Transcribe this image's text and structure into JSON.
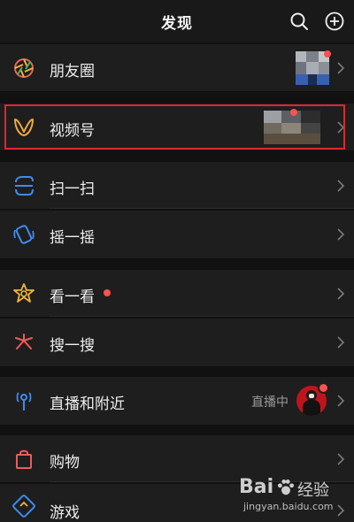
{
  "header": {
    "title": "发现",
    "search_icon": "search-icon",
    "add_icon": "plus-circle-icon"
  },
  "items": [
    {
      "label": "朋友圈",
      "icon": "moments-aperture-icon",
      "icon_color": "#e06a52"
    },
    {
      "label": "视频号",
      "icon": "channels-butterfly-icon",
      "icon_color": "#f2a93b"
    },
    {
      "label": "扫一扫",
      "icon": "scan-icon",
      "icon_color": "#3d8cf0"
    },
    {
      "label": "摇一摇",
      "icon": "shake-phone-icon",
      "icon_color": "#3d8cf0"
    },
    {
      "label": "看一看",
      "icon": "top-stories-icon",
      "icon_color": "#f2b33b"
    },
    {
      "label": "搜一搜",
      "icon": "search-star-icon",
      "icon_color": "#f05a5a"
    },
    {
      "label": "直播和附近",
      "icon": "live-nearby-icon",
      "icon_color": "#3d8cf0",
      "status": "直播中"
    },
    {
      "label": "购物",
      "icon": "shopping-bag-icon",
      "icon_color": "#f05a5a"
    },
    {
      "label": "游戏",
      "icon": "game-controller-icon",
      "icon_color": "#3d8cf0"
    }
  ],
  "colors": {
    "background": "#111111",
    "row": "#1e1e1e",
    "badge_red": "#fa5151",
    "highlight_box": "#e0262c"
  },
  "watermark": {
    "brand": "Bai",
    "brand_suffix": "经验",
    "url": "jingyan.baidu.com"
  }
}
